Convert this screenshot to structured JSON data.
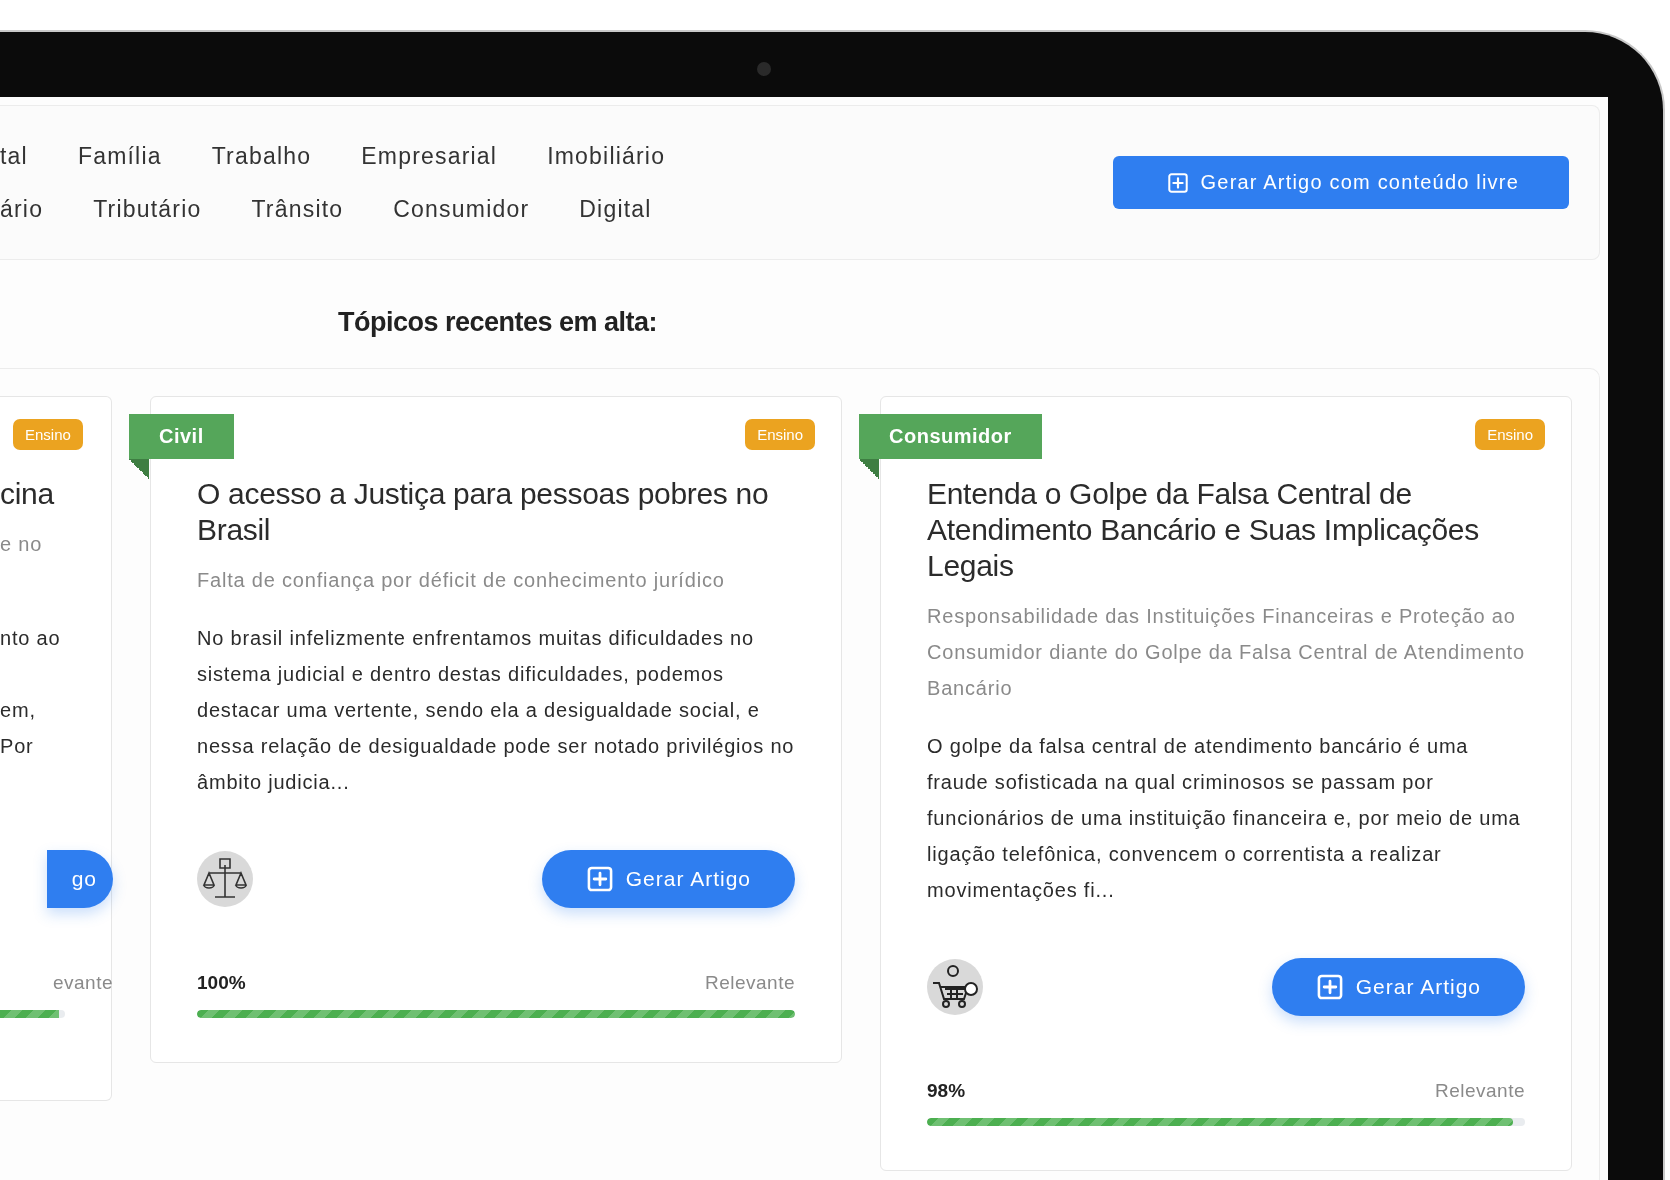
{
  "nav": {
    "rows": [
      [
        {
          "label": "tal"
        },
        {
          "label": "Família"
        },
        {
          "label": "Trabalho"
        },
        {
          "label": "Empresarial"
        },
        {
          "label": "Imobiliário"
        }
      ],
      [
        {
          "label": "ário"
        },
        {
          "label": "Tributário"
        },
        {
          "label": "Trânsito"
        },
        {
          "label": "Consumidor"
        },
        {
          "label": "Digital"
        }
      ]
    ],
    "action_button": {
      "label": "Gerar Artigo com conteúdo livre"
    }
  },
  "section_title": "Tópicos recentes em alta:",
  "cards": [
    {
      "kind": "partial",
      "badge": "Ensino",
      "title": "cina",
      "subtitle": "e no",
      "body": "\nnto ao\n\nem,\nPor",
      "button": "go",
      "relevance_label": "evante",
      "level": 0.9
    },
    {
      "kind": "full",
      "category": "Civil",
      "badge": "Ensino",
      "title": "O acesso a Justiça para pessoas pobres no Brasil",
      "subtitle": "Falta de confiança por déficit de conhecimento jurídico",
      "body": "No brasil infelizmente enfrentamos muitas dificuldades no sistema judicial e dentro destas dificuldades, podemos destacar uma vertente, sendo ela a desigualdade social, e nessa relação de desigualdade pode ser notado privilégios no âmbito judicia...",
      "button": "Gerar Artigo",
      "percent": "100%",
      "relevance_label": "Relevante",
      "level": 1
    },
    {
      "kind": "full",
      "category": "Consumidor",
      "badge": "Ensino",
      "title": "Entenda o Golpe da Falsa Central de Atendimento Bancário e Suas Implicações Legais",
      "subtitle": "Responsabilidade das Instituições Financeiras e Proteção ao Consumidor diante do Golpe da Falsa Central de Atendimento Bancário",
      "body": "O golpe da falsa central de atendimento bancário é uma fraude sofisticada na qual criminosos se passam por funcionários de uma instituição financeira e, por meio de uma ligação telefônica, convencem o correntista a realizar movimentações fi...",
      "button": "Gerar Artigo",
      "percent": "98%",
      "relevance_label": "Relevante",
      "level": 0.98
    }
  ]
}
